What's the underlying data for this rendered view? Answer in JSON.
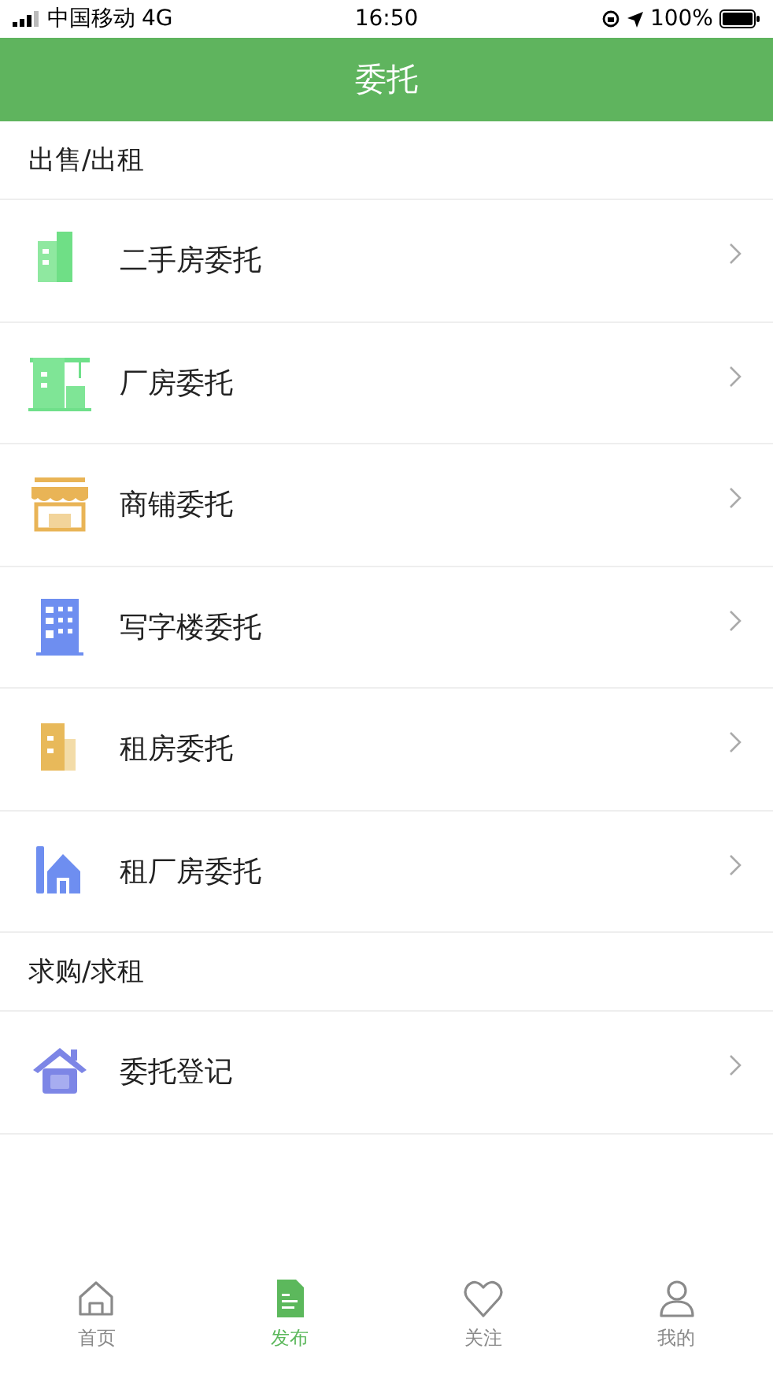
{
  "status_bar": {
    "carrier": "中国移动",
    "network": "4G",
    "time": "16:50",
    "battery": "100%"
  },
  "header": {
    "title": "委托"
  },
  "sections": [
    {
      "title": "出售/出租",
      "items": [
        {
          "label": "二手房委托",
          "kind": "building"
        },
        {
          "label": "厂房委托",
          "kind": "factory"
        },
        {
          "label": "商铺委托",
          "kind": "shop"
        },
        {
          "label": "写字楼委托",
          "kind": "office"
        },
        {
          "label": "租房委托",
          "kind": "rent"
        },
        {
          "label": "租厂房委托",
          "kind": "warehouse"
        }
      ]
    },
    {
      "title": "求购/求租",
      "items": [
        {
          "label": "委托登记",
          "kind": "register"
        }
      ]
    }
  ],
  "tab_bar": [
    {
      "label": "首页",
      "kind": "home",
      "selected": false
    },
    {
      "label": "发布",
      "kind": "publish",
      "selected": true
    },
    {
      "label": "关注",
      "kind": "heart",
      "selected": false
    },
    {
      "label": "我的",
      "kind": "user",
      "selected": false
    }
  ]
}
